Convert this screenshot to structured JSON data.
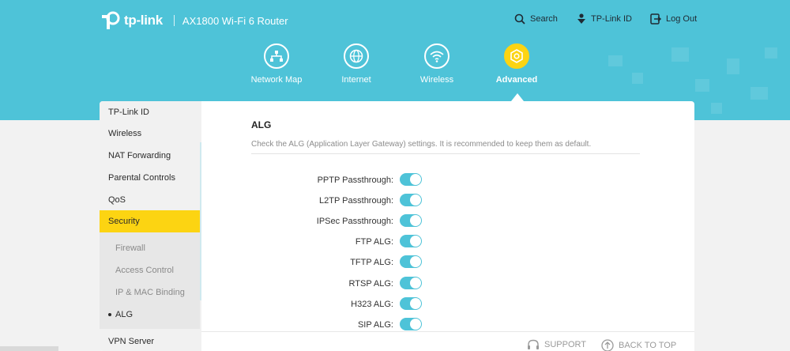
{
  "header": {
    "brand": "tp-link",
    "model": "AX1800 Wi-Fi 6 Router",
    "links": [
      {
        "label": "Search",
        "icon": "search-icon"
      },
      {
        "label": "TP-Link ID",
        "icon": "tplink-id-icon"
      },
      {
        "label": "Log Out",
        "icon": "logout-icon"
      }
    ]
  },
  "nav": [
    {
      "label": "Network Map",
      "icon": "network-map-icon",
      "active": false
    },
    {
      "label": "Internet",
      "icon": "globe-icon",
      "active": false
    },
    {
      "label": "Wireless",
      "icon": "wifi-icon",
      "active": false
    },
    {
      "label": "Advanced",
      "icon": "gear-icon",
      "active": true
    }
  ],
  "sidebar": {
    "items": [
      "TP-Link ID",
      "Wireless",
      "NAT Forwarding",
      "Parental Controls",
      "QoS",
      "Security"
    ],
    "active": "Security",
    "subitems": [
      "Firewall",
      "Access Control",
      "IP & MAC Binding",
      "ALG"
    ],
    "current": "ALG",
    "after": "VPN Server"
  },
  "main": {
    "title": "ALG",
    "description": "Check the ALG (Application Layer Gateway) settings. It is recommended to keep them as default.",
    "settings": [
      {
        "label": "PPTP Passthrough:",
        "enabled": true
      },
      {
        "label": "L2TP Passthrough:",
        "enabled": true
      },
      {
        "label": "IPSec Passthrough:",
        "enabled": true
      },
      {
        "label": "FTP ALG:",
        "enabled": true
      },
      {
        "label": "TFTP ALG:",
        "enabled": true
      },
      {
        "label": "RTSP ALG:",
        "enabled": true
      },
      {
        "label": "H323 ALG:",
        "enabled": true
      },
      {
        "label": "SIP ALG:",
        "enabled": true
      }
    ]
  },
  "footer": {
    "support": "SUPPORT",
    "back_to_top": "BACK TO TOP"
  },
  "colors": {
    "header_bg": "#4ec3d8",
    "accent_yellow": "#fcd412",
    "toggle_on": "#4ec3d8"
  }
}
